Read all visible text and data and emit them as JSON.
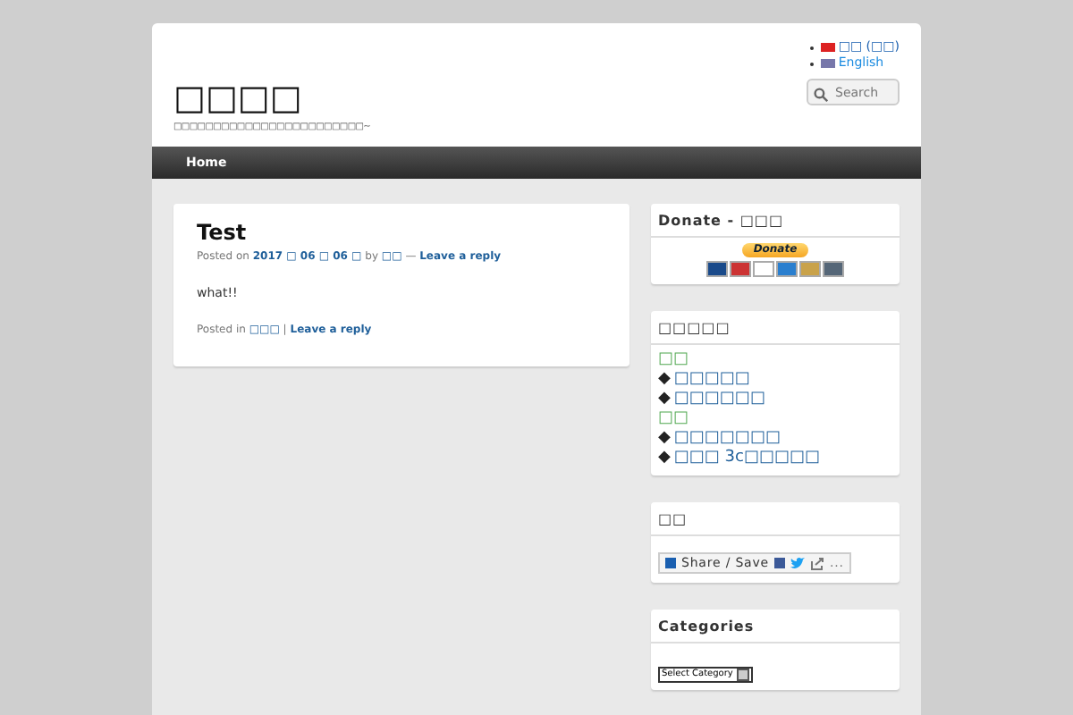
{
  "site": {
    "title": "□□□□",
    "tagline": "□□□□□□□□□□□□□□□□□□□□□□□□~"
  },
  "languages": [
    {
      "label": "□□ (□□)",
      "selected": true,
      "kind": "tw"
    },
    {
      "label": "English",
      "selected": false,
      "kind": "us"
    }
  ],
  "search": {
    "placeholder": "Search"
  },
  "nav": [
    {
      "label": "Home",
      "selected": true
    }
  ],
  "post": {
    "title": "Test",
    "posted_on": "Posted on",
    "date": "2017 □ 06 □ 06 □",
    "by": "by",
    "author": "□□",
    "sep": "—",
    "reply": "Leave a reply",
    "body": "what!!",
    "posted_in": "Posted in",
    "category": "□□□",
    "bar": "|",
    "reply2": "Leave a reply"
  },
  "donate": {
    "title": "Donate - □□□",
    "button": "Donate"
  },
  "links": {
    "title": "□□□□□",
    "groups": [
      {
        "heading": "□□",
        "items": [
          "□□□□□",
          "□□□□□□"
        ]
      },
      {
        "heading": "□□",
        "items": [
          "□□□□□□□",
          "□□□ 3c□□□□□"
        ]
      }
    ],
    "bullet": "◆"
  },
  "share": {
    "title": "□□",
    "button": "Share / Save",
    "more": "..."
  },
  "categories": {
    "title": "Categories",
    "select": "Select Category"
  }
}
